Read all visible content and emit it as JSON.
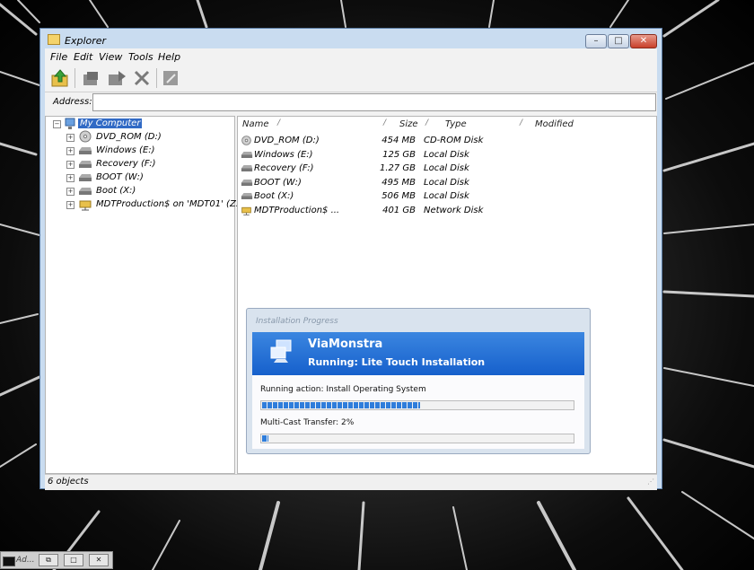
{
  "window": {
    "title": "Explorer",
    "minimize": "–",
    "maximize": "□",
    "close": "✕"
  },
  "menu": [
    "File",
    "Edit",
    "View",
    "Tools",
    "Help"
  ],
  "toolbar": {
    "buttons": [
      "up-folder-icon",
      "copy-icon",
      "move-icon",
      "delete-icon",
      "rename-icon"
    ]
  },
  "address": {
    "label": "Address:",
    "value": ""
  },
  "tree": {
    "root": "My Computer",
    "items": [
      "DVD_ROM (D:)",
      "Windows (E:)",
      "Recovery (F:)",
      "BOOT (W:)",
      "Boot (X:)",
      "MDTProduction$ on 'MDT01' (Z:)"
    ]
  },
  "list": {
    "columns": [
      "Name",
      "Size",
      "Type",
      "Modified"
    ],
    "rows": [
      {
        "name": "DVD_ROM (D:)",
        "size": "454 MB",
        "type": "CD-ROM Disk",
        "icon": "cdrom-icon"
      },
      {
        "name": "Windows (E:)",
        "size": "125 GB",
        "type": "Local Disk",
        "icon": "drive-icon"
      },
      {
        "name": "Recovery (F:)",
        "size": "1.27 GB",
        "type": "Local Disk",
        "icon": "drive-icon"
      },
      {
        "name": "BOOT (W:)",
        "size": "495 MB",
        "type": "Local Disk",
        "icon": "drive-icon"
      },
      {
        "name": "Boot (X:)",
        "size": "506 MB",
        "type": "Local Disk",
        "icon": "drive-icon"
      },
      {
        "name": "MDTProduction$ ...",
        "size": "401 GB",
        "type": "Network Disk",
        "icon": "network-drive-icon"
      }
    ]
  },
  "status": {
    "text": "6 objects"
  },
  "progress": {
    "title": "Installation Progress",
    "brand": "ViaMonstra",
    "phase": "Running: Lite Touch Installation",
    "action_label": "Running action: Install Operating System",
    "action_fraction": 0.51,
    "transfer_label": "Multi-Cast Transfer: 2%",
    "transfer_fraction": 0.02,
    "accent": "#1d6ad6"
  },
  "taskbar": {
    "label": "Ad...",
    "buttons": [
      "⧉",
      "□",
      "✕"
    ]
  }
}
